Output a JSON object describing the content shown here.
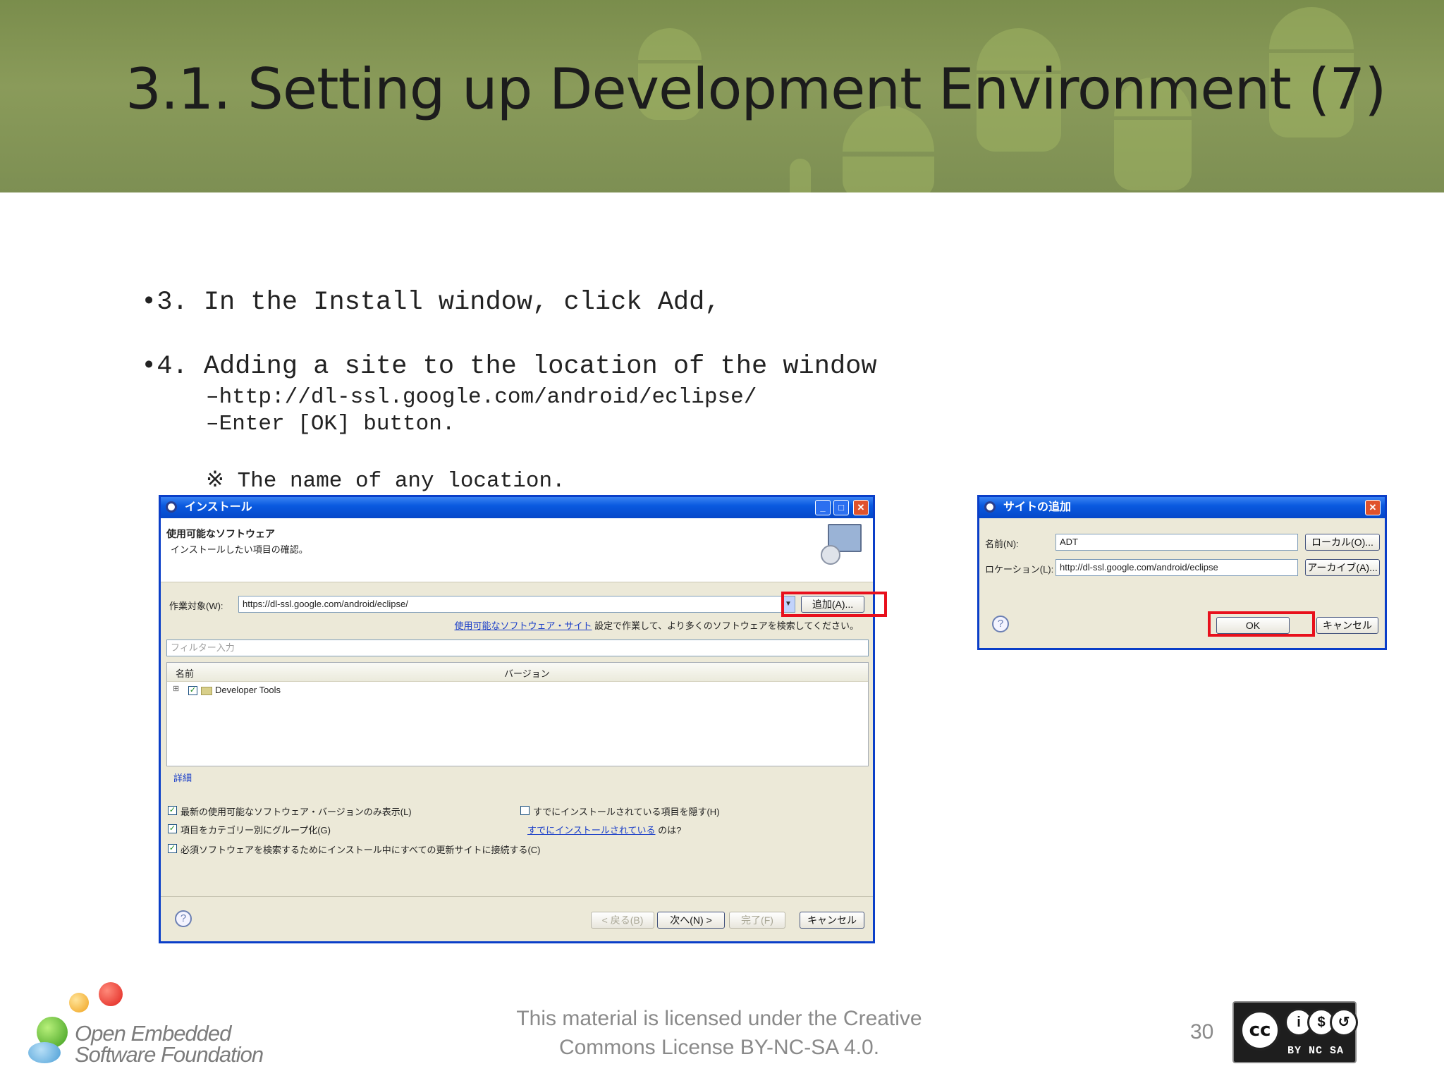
{
  "slide": {
    "title": "3.1. Setting up Development Environment (7)",
    "bullets": {
      "step3": "•3.  In the Install window, click Add,",
      "step4": "•4.  Adding a site to the location of the window",
      "sub_url": "–http://dl-ssl.google.com/android/eclipse/",
      "sub_ok": "–Enter [OK] button.",
      "note": "※ The name of any location."
    },
    "footer": {
      "logo_line1": "Open Embedded",
      "logo_line2": "Software Foundation",
      "license_line1": "This material is licensed under the Creative",
      "license_line2": "Commons License BY-NC-SA 4.0.",
      "page_number": "30",
      "cc_logo": "cc",
      "cc_labels": "BY NC SA"
    }
  },
  "install_window": {
    "title": "インストール",
    "heading": "使用可能なソフトウェア",
    "subheading": "インストールしたい項目の確認。",
    "work_with_label": "作業対象(W):",
    "work_with_value": "https://dl-ssl.google.com/android/eclipse/",
    "add_button": "追加(A)...",
    "sites_link": "使用可能なソフトウェア・サイト",
    "sites_hint": "設定で作業して、より多くのソフトウェアを検索してください。",
    "filter_placeholder": "フィルター入力",
    "columns": {
      "name": "名前",
      "version": "バージョン"
    },
    "tree_item": "Developer Tools",
    "details_label": "詳細",
    "options": {
      "latest_only": "最新の使用可能なソフトウェア・バージョンのみ表示(L)",
      "group_by_category": "項目をカテゴリー別にグループ化(G)",
      "contact_all_sites": "必須ソフトウェアを検索するためにインストール中にすべての更新サイトに接続する(C)",
      "hide_installed": "すでにインストールされている項目を隠す(H)",
      "already_installed_link": "すでにインストールされている",
      "already_installed_suffix": "のは?"
    },
    "buttons": {
      "back": "< 戻る(B)",
      "next": "次へ(N) >",
      "finish": "完了(F)",
      "cancel": "キャンセル"
    }
  },
  "add_site_dialog": {
    "title": "サイトの追加",
    "name_label": "名前(N):",
    "name_value": "ADT",
    "location_label": "ロケーション(L):",
    "location_value": "http://dl-ssl.google.com/android/eclipse",
    "local_button": "ローカル(O)...",
    "archive_button": "アーカイブ(A)...",
    "ok_button": "OK",
    "cancel_button": "キャンセル"
  },
  "colors": {
    "banner": "#7d8f53",
    "highlight": "#e8101c",
    "xp_title": "#0a5ae0"
  }
}
